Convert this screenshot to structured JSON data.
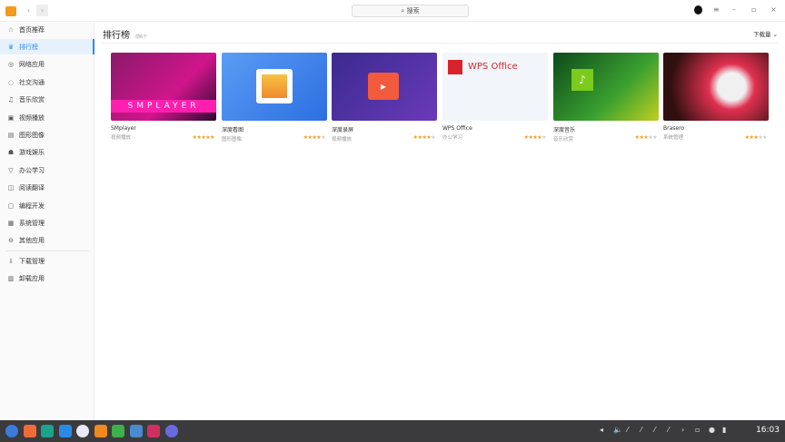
{
  "window": {
    "search_placeholder": "搜索",
    "controls": [
      "menu",
      "minimize",
      "maximize",
      "close"
    ]
  },
  "sidebar": {
    "items": [
      {
        "label": "首页推荐",
        "icon": "star-icon"
      },
      {
        "label": "排行榜",
        "icon": "crown-icon",
        "active": true
      },
      {
        "label": "网络应用",
        "icon": "globe-icon"
      },
      {
        "label": "社交沟通",
        "icon": "chat-icon"
      },
      {
        "label": "音乐欣赏",
        "icon": "music-icon"
      },
      {
        "label": "视频播放",
        "icon": "video-icon"
      },
      {
        "label": "图形图像",
        "icon": "image-icon"
      },
      {
        "label": "游戏娱乐",
        "icon": "gamepad-icon"
      },
      {
        "label": "办公学习",
        "icon": "office-icon"
      },
      {
        "label": "阅读翻译",
        "icon": "book-icon"
      },
      {
        "label": "编程开发",
        "icon": "code-icon"
      },
      {
        "label": "系统管理",
        "icon": "system-icon"
      },
      {
        "label": "其他应用",
        "icon": "other-icon"
      },
      {
        "label": "下载管理",
        "icon": "download-icon"
      },
      {
        "label": "卸载应用",
        "icon": "trash-icon"
      }
    ]
  },
  "main": {
    "title": "排行榜",
    "subtitle": "前6个",
    "sort_label": "下载量",
    "apps": [
      {
        "name": "SMplayer",
        "category": "视频播放",
        "rating": 5,
        "banner_text": "SMPLAYER",
        "color": "#b0157d"
      },
      {
        "name": "深度看图",
        "category": "图形图像",
        "rating": 4,
        "color": "#3f86ef"
      },
      {
        "name": "深度录屏",
        "category": "视频播放",
        "rating": 4,
        "color": "#4a35a8"
      },
      {
        "name": "WPS Office",
        "category": "办公学习",
        "rating": 4,
        "banner_text": "WPS Office",
        "color": "#f4f7fb"
      },
      {
        "name": "深度音乐",
        "category": "音乐欣赏",
        "rating": 3,
        "color": "#1f6b2a"
      },
      {
        "name": "Brasero",
        "category": "系统管理",
        "rating": 3,
        "color": "#c3243f"
      }
    ]
  },
  "taskbar": {
    "clock": "16:03"
  }
}
